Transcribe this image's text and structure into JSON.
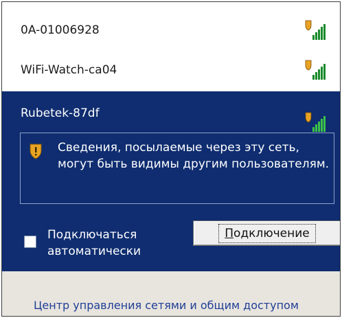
{
  "networks": [
    {
      "name": "0A-01006928",
      "secured": true,
      "signal": 5
    },
    {
      "name": "WiFi-Watch-ca04",
      "secured": true,
      "signal": 5
    }
  ],
  "selected": {
    "name": "Rubetek-87df",
    "secured": true,
    "signal": 5,
    "warning_text": "Сведения, посылаемые через эту сеть, могут быть видимы другим пользователям.",
    "auto_connect_label": "Подключаться автоматически",
    "auto_connect_checked": false,
    "connect_button": {
      "accel": "П",
      "rest": "одключение"
    }
  },
  "footer": {
    "link_text": "Центр управления сетями и общим доступом"
  },
  "colors": {
    "selection": "#0f2d70",
    "link": "#1f3f96",
    "signal": "#1a8a2a",
    "shield": "#e9a325"
  }
}
